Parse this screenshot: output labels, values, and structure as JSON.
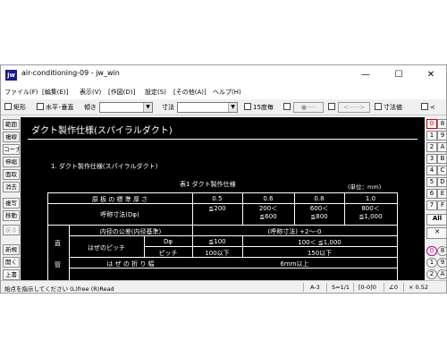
{
  "window": {
    "title": "air-conditioning-09 - jw_win",
    "icon_label": "jw",
    "minimize": "—",
    "maximize": "☐",
    "close": "✕"
  },
  "menu": [
    "ファイル(F)",
    "[編集(E)]",
    "表示(V)",
    "[作図(D)]",
    "設定(S)",
    "[その他(A)]",
    "ヘルプ(H)"
  ],
  "toolbar": {
    "rect": "矩形",
    "horiz_vert": "水平･垂直",
    "tilt": "傾き",
    "dim": "寸法",
    "deg15": "15度毎",
    "circle_btn": "●----",
    "arrow_btn": "<----->",
    "dim_value": "寸法値",
    "less": "<"
  },
  "left_tools": [
    "範囲",
    "複線",
    "コーナー",
    "伸縮",
    "面取",
    "消去",
    "複写",
    "移動",
    "戻る",
    "新規",
    "開く",
    "上書"
  ],
  "right_tools": {
    "grid": [
      [
        "0",
        "8"
      ],
      [
        "1",
        "9"
      ],
      [
        "2",
        "A"
      ],
      [
        "3",
        "B"
      ],
      [
        "4",
        "C"
      ],
      [
        "5",
        "D"
      ],
      [
        "6",
        "E"
      ],
      [
        "7",
        "F"
      ]
    ],
    "all": "All",
    "x": "✕",
    "circles": [
      [
        "0",
        "8"
      ],
      [
        "1",
        "9"
      ],
      [
        "2",
        "A"
      ]
    ]
  },
  "drawing": {
    "heading": "ダクト製作仕様(スパイラルダクト)",
    "section": "1. ダクト製作仕様(スパイラルダクト)",
    "table_title": "表1 ダクト製作仕様",
    "unit": "(単位：mm)",
    "row_thickness": "原 板 の 標 準 厚 さ",
    "thickness_values": [
      "0.5",
      "0.6",
      "0.8",
      "1.0"
    ],
    "row_dim": "呼称寸法(Dφ)",
    "dim_values": [
      "≦200",
      "200＜\n≦600",
      "600＜\n≦800",
      "800＜\n≦1,000"
    ],
    "row_tolerance_label": "内径の公差(内径基準)",
    "row_tolerance_value": "(呼称寸法) +2～-0",
    "side_label_1": "直",
    "side_label_2": "管",
    "row_pitch": "はぜのピッチ",
    "col_dphi": "Dφ",
    "pitch_dphi_1": "≦100",
    "pitch_dphi_2": "100＜ ≦1,000",
    "col_pitch": "ピッチ",
    "pitch_value_1": "100以下",
    "pitch_value_2": "150以下",
    "row_seam": "は ぜ の 折 り 幅",
    "seam_value": "6mm以上"
  },
  "status": {
    "message": "始点を指示してください (L)free (R)Read",
    "scale": "A-3",
    "ratio": "S=1/1",
    "layer": "[0-0]0",
    "angle": "∠0",
    "zoom": "× 0.52"
  }
}
